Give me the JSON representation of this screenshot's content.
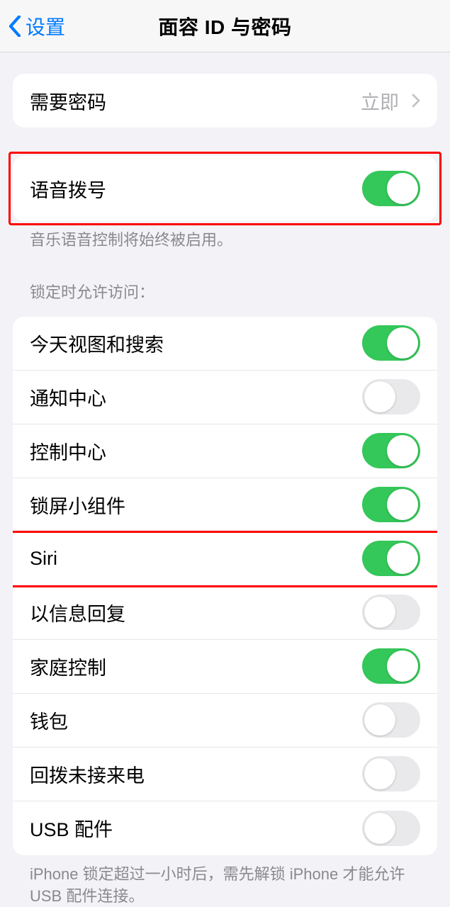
{
  "nav": {
    "back_label": "设置",
    "title": "面容 ID 与密码"
  },
  "require_passcode": {
    "label": "需要密码",
    "value": "立即"
  },
  "voice_dial": {
    "label": "语音拨号",
    "on": true,
    "footer": "音乐语音控制将始终被启用。"
  },
  "lock_access": {
    "header": "锁定时允许访问：",
    "items": [
      {
        "label": "今天视图和搜索",
        "on": true
      },
      {
        "label": "通知中心",
        "on": false
      },
      {
        "label": "控制中心",
        "on": true
      },
      {
        "label": "锁屏小组件",
        "on": true
      },
      {
        "label": "Siri",
        "on": true
      },
      {
        "label": "以信息回复",
        "on": false
      },
      {
        "label": "家庭控制",
        "on": true
      },
      {
        "label": "钱包",
        "on": false
      },
      {
        "label": "回拨未接来电",
        "on": false
      },
      {
        "label": "USB 配件",
        "on": false
      }
    ],
    "footer": "iPhone 锁定超过一小时后，需先解锁 iPhone 才能允许 USB 配件连接。"
  },
  "highlights": {
    "voice_dial": true,
    "siri_index": 4
  }
}
